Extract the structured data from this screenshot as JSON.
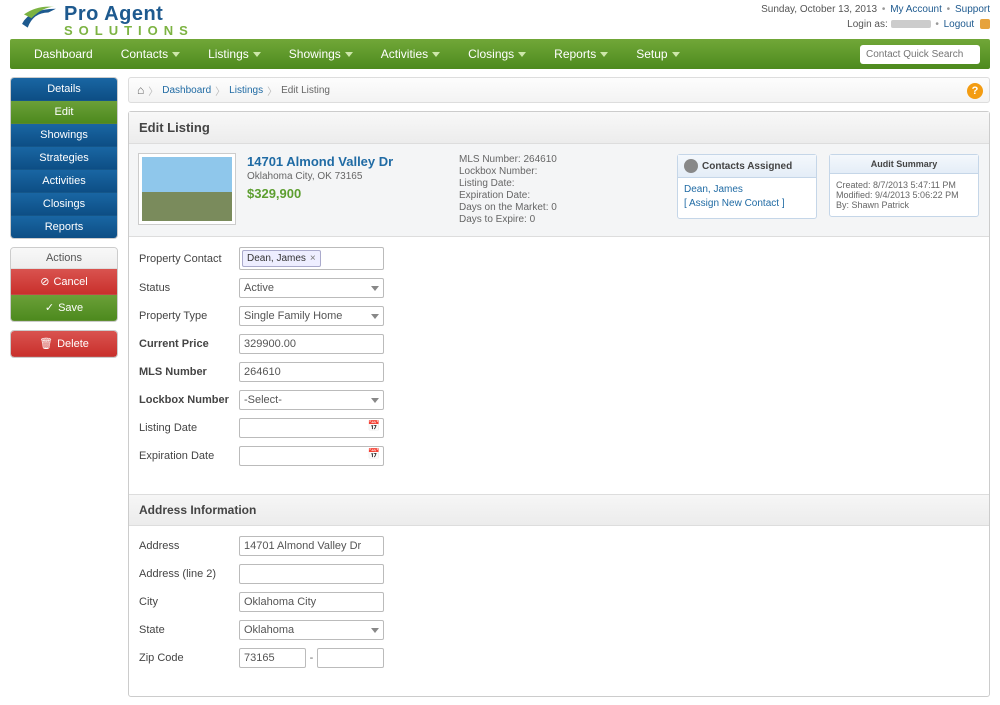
{
  "header": {
    "date": "Sunday, October 13, 2013",
    "my_account": "My Account",
    "support": "Support",
    "login_as": "Login as:",
    "logout": "Logout",
    "logo_line1": "Pro Agent",
    "logo_line2": "SOLUTIONS"
  },
  "nav": {
    "items": [
      "Dashboard",
      "Contacts",
      "Listings",
      "Showings",
      "Activities",
      "Closings",
      "Reports",
      "Setup"
    ],
    "search_placeholder": "Contact Quick Search"
  },
  "breadcrumb": {
    "items": [
      "Dashboard",
      "Listings",
      "Edit Listing"
    ]
  },
  "sidebar": {
    "tabs": [
      "Details",
      "Edit",
      "Showings",
      "Strategies",
      "Activities",
      "Closings",
      "Reports"
    ],
    "actions_head": "Actions",
    "cancel": "Cancel",
    "save": "Save",
    "delete": "Delete"
  },
  "page": {
    "title": "Edit Listing",
    "address": "14701 Almond Valley Dr",
    "city_state": "Oklahoma City, OK 73165",
    "price": "$329,900",
    "mls": {
      "mls_number": "MLS Number: 264610",
      "lockbox": "Lockbox Number:",
      "listing_date": "Listing Date:",
      "expiration": "Expiration Date:",
      "dom": "Days on the Market: 0",
      "dte": "Days to Expire: 0"
    },
    "contacts_box": {
      "title": "Contacts Assigned",
      "contact": "Dean, James",
      "assign": "[ Assign New Contact ]"
    },
    "audit_box": {
      "title": "Audit Summary",
      "created": "Created: 8/7/2013 5:47:11 PM",
      "modified": "Modified: 9/4/2013 5:06:22 PM",
      "by": "By: Shawn Patrick"
    }
  },
  "form": {
    "property_contact_label": "Property Contact",
    "property_contact_value": "Dean, James",
    "status_label": "Status",
    "status_value": "Active",
    "property_type_label": "Property Type",
    "property_type_value": "Single Family Home",
    "current_price_label": "Current Price",
    "current_price_value": "329900.00",
    "mls_label": "MLS Number",
    "mls_value": "264610",
    "lockbox_label": "Lockbox Number",
    "lockbox_value": "-Select-",
    "listing_date_label": "Listing Date",
    "listing_date_value": "",
    "expiration_label": "Expiration Date",
    "expiration_value": ""
  },
  "address_section": {
    "head": "Address Information",
    "address_label": "Address",
    "address_value": "14701 Almond Valley Dr",
    "address2_label": "Address (line 2)",
    "address2_value": "",
    "city_label": "City",
    "city_value": "Oklahoma City",
    "state_label": "State",
    "state_value": "Oklahoma",
    "zip_label": "Zip Code",
    "zip_value": "73165",
    "zip2_value": ""
  }
}
